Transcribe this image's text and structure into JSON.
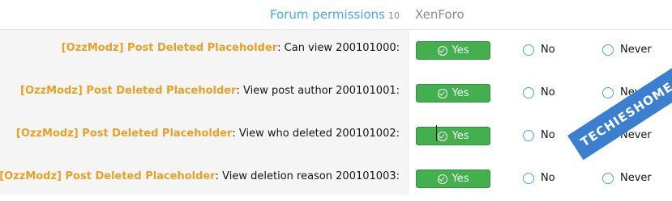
{
  "header": {
    "title": "Forum permissions",
    "count": "10",
    "site": "XenForo"
  },
  "options": {
    "yes": "Yes",
    "no": "No",
    "never": "Never"
  },
  "permissions": [
    {
      "addon": "[OzzModz] Post Deleted Placeholder",
      "label": ": Can view 200101000:",
      "selected": "Yes"
    },
    {
      "addon": "[OzzModz] Post Deleted Placeholder",
      "label": ": View post author 200101001:",
      "selected": "Yes"
    },
    {
      "addon": "[OzzModz] Post Deleted Placeholder",
      "label": ": View who deleted 200101002:",
      "selected": "Yes"
    },
    {
      "addon": "[OzzModz] Post Deleted Placeholder",
      "label": ": View deletion reason 200101003:",
      "selected": "Yes"
    }
  ],
  "watermark": "TECHIESHOME.COM",
  "colors": {
    "accent": "#47a7eb",
    "addon": "#e7a223",
    "yes_button": "#42b04c"
  }
}
